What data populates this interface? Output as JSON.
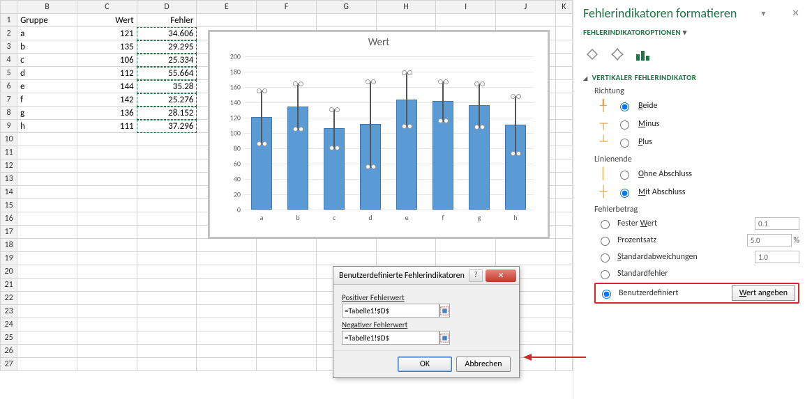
{
  "columns": [
    "B",
    "C",
    "D",
    "E",
    "F",
    "G",
    "H",
    "I",
    "J",
    "K"
  ],
  "row_count": 27,
  "headers": {
    "B": "Gruppe",
    "C": "Wert",
    "D": "Fehler"
  },
  "rows": [
    {
      "g": "a",
      "v": 121,
      "e": 34.606
    },
    {
      "g": "b",
      "v": 135,
      "e": 29.295
    },
    {
      "g": "c",
      "v": 106,
      "e": 25.334
    },
    {
      "g": "d",
      "v": 112,
      "e": 55.664
    },
    {
      "g": "e",
      "v": 144,
      "e": 35.28
    },
    {
      "g": "f",
      "v": 142,
      "e": 25.276
    },
    {
      "g": "g",
      "v": 136,
      "e": 28.152
    },
    {
      "g": "h",
      "v": 111,
      "e": 37.296
    }
  ],
  "chart_data": {
    "type": "bar",
    "title": "Wert",
    "categories": [
      "a",
      "b",
      "c",
      "d",
      "e",
      "f",
      "g",
      "h"
    ],
    "values": [
      121,
      135,
      106,
      112,
      144,
      142,
      136,
      111
    ],
    "errors": [
      34.606,
      29.295,
      25.334,
      55.664,
      35.28,
      25.276,
      28.152,
      37.296
    ],
    "ylim": [
      0,
      200
    ],
    "ystep": 20,
    "xlabel": "",
    "ylabel": ""
  },
  "dialog": {
    "title": "Benutzerdefinierte Fehlerindikatoren",
    "pos_label": "Positiver Fehlerwert",
    "pos_value": "=Tabelle1!$D$",
    "neg_label": "Negativer Fehlerwert",
    "neg_value": "=Tabelle1!$D$",
    "ok": "OK",
    "cancel": "Abbrechen"
  },
  "pane": {
    "title": "Fehlerindikatoren formatieren",
    "subtitle": "FEHLERINDIKATOROPTIONEN",
    "section": "VERTIKALER FEHLERINDIKATOR",
    "dir_label": "Richtung",
    "dir_opts": {
      "both": "Beide",
      "minus": "Minus",
      "plus": "Plus"
    },
    "end_label": "Linienende",
    "end_opts": {
      "none": "Ohne Abschluss",
      "cap": "Mit Abschluss"
    },
    "amt_label": "Fehlerbetrag",
    "amt_opts": {
      "fixed": "Fester Wert",
      "fixed_val": "0.1",
      "pct": "Prozentsatz",
      "pct_val": "5.0",
      "stdev": "Standardabweichungen",
      "stdev_val": "1.0",
      "stderr": "Standardfehler",
      "custom": "Benutzerdefiniert"
    },
    "specify_btn": "Wert angeben"
  }
}
